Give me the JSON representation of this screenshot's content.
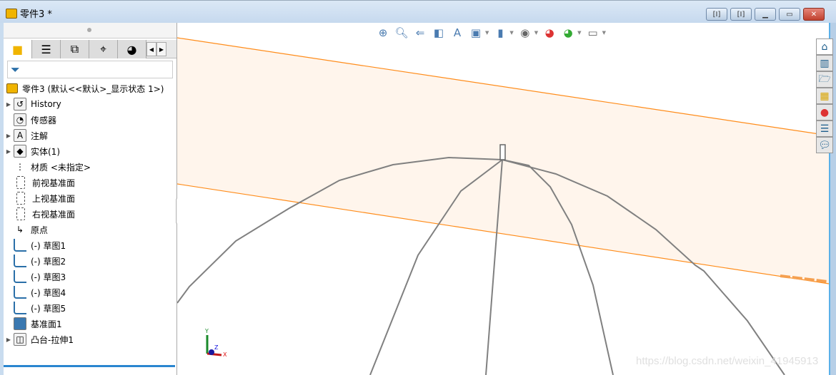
{
  "window": {
    "title": "零件3 *",
    "buttons": [
      "restore-left",
      "restore-right",
      "minimize",
      "maximize",
      "close"
    ]
  },
  "panel": {
    "tabs": [
      "feature-manager",
      "property-manager",
      "configuration-manager",
      "dimxpert",
      "display-manager"
    ],
    "filter_icon": "filter-icon",
    "root": "零件3  (默认<<默认>_显示状态 1>)",
    "items": [
      {
        "label": "History",
        "expand": true,
        "icon": "history-folder-icon"
      },
      {
        "label": "传感器",
        "expand": false,
        "icon": "sensor-folder-icon"
      },
      {
        "label": "注解",
        "expand": true,
        "icon": "annotation-folder-icon"
      },
      {
        "label": "实体(1)",
        "expand": true,
        "icon": "solid-body-folder-icon"
      },
      {
        "label": "材质 <未指定>",
        "expand": false,
        "icon": "material-icon"
      },
      {
        "label": "前视基准面",
        "expand": false,
        "icon": "plane-icon"
      },
      {
        "label": "上视基准面",
        "expand": false,
        "icon": "plane-icon"
      },
      {
        "label": "右视基准面",
        "expand": false,
        "icon": "plane-icon"
      },
      {
        "label": "原点",
        "expand": false,
        "icon": "origin-icon"
      },
      {
        "label": "(-) 草图1",
        "expand": false,
        "icon": "sketch-icon"
      },
      {
        "label": "(-) 草图2",
        "expand": false,
        "icon": "sketch-icon"
      },
      {
        "label": "(-) 草图3",
        "expand": false,
        "icon": "sketch-icon"
      },
      {
        "label": "(-) 草图4",
        "expand": false,
        "icon": "sketch-icon"
      },
      {
        "label": "(-) 草图5",
        "expand": false,
        "icon": "sketch-icon"
      },
      {
        "label": "基准面1",
        "expand": false,
        "icon": "plane-feature-icon"
      },
      {
        "label": "凸台-拉伸1",
        "expand": true,
        "icon": "boss-extrude-icon"
      }
    ]
  },
  "toolbar": [
    "zoom-to-fit-icon",
    "zoom-to-area-icon",
    "previous-view-icon",
    "section-view-icon",
    "dynamic-annotation-icon",
    "view-orientation-icon",
    "display-style-icon",
    "hide-show-icon",
    "edit-appearance-icon",
    "apply-scene-icon",
    "view-settings-icon"
  ],
  "taskpane": [
    "home-icon",
    "design-library-icon",
    "file-explorer-icon",
    "view-palette-icon",
    "appearances-icon",
    "custom-properties-icon",
    "forum-icon"
  ],
  "triad": {
    "x": "X",
    "y": "Y",
    "z": "Z"
  },
  "watermark": "https://blog.csdn.net/weixin_41945913",
  "colors": {
    "plane_edge": "#ff8c1a",
    "plane_fill": "#fff5ec",
    "wire": "#808080",
    "accent": "#2a86d0"
  }
}
